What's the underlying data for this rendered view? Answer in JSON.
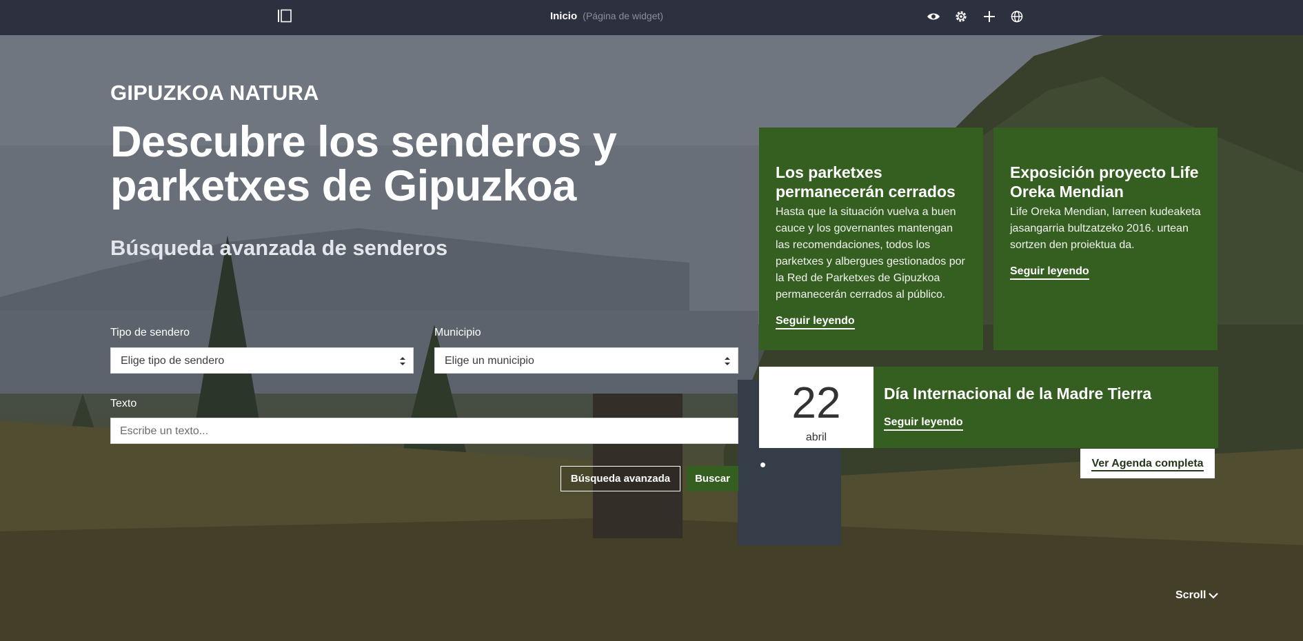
{
  "topbar": {
    "page_title": "Inicio",
    "page_subtitle": "(Página de widget)",
    "icons": [
      "panel-toggle-icon",
      "eye-icon",
      "gear-icon",
      "plus-icon",
      "globe-icon"
    ]
  },
  "hero": {
    "eyebrow": "GIPUZKOA NATURA",
    "headline": "Descubre los senderos y parketxes de Gipuzkoa",
    "subhead": "Búsqueda avanzada de senderos"
  },
  "search": {
    "type_label": "Tipo de sendero",
    "type_value": "Elige tipo de sendero",
    "municipality_label": "Municipio",
    "municipality_value": "Elige un municipio",
    "text_label": "Texto",
    "text_placeholder": "Escribe un texto...",
    "advanced_button": "Búsqueda avanzada",
    "search_button": "Buscar"
  },
  "news": [
    {
      "title": "Los parketxes permanecerán cerrados",
      "body": "Hasta que la situación vuelva a buen cauce y los governantes mantengan las recomendaciones, todos los parketxes y albergues gestionados por la Red de Parketxes de Gipuzkoa permanecerán cerrados al público.",
      "link": "Seguir leyendo"
    },
    {
      "title": "Exposición proyecto Life Oreka Mendian",
      "body": "Life Oreka Mendian, larreen kudeaketa jasangarria bultzatzeko 2016. urtean sortzen den proiektua da.",
      "link": "Seguir leyendo"
    }
  ],
  "event": {
    "day": "22",
    "month": "abril",
    "title": "Día Internacional de la Madre Tierra",
    "link": "Seguir leyendo",
    "agenda_button": "Ver Agenda completa"
  },
  "scroll_label": "Scroll",
  "colors": {
    "topbar": "#2d303e",
    "accent_green": "#355e21",
    "white": "#ffffff"
  }
}
